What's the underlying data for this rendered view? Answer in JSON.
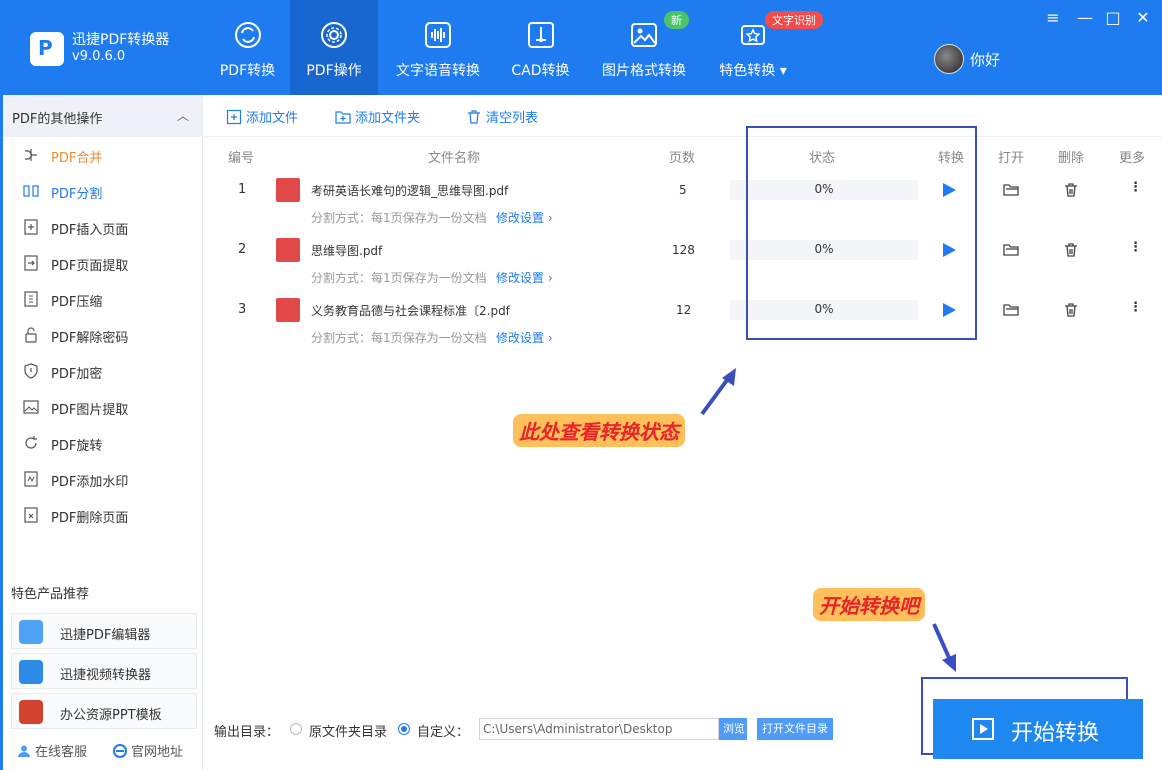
{
  "app": {
    "name": "迅捷PDF转换器",
    "version": "v9.0.6.0",
    "user": "你好"
  },
  "nav": {
    "tabs": [
      {
        "label": "PDF转换"
      },
      {
        "label": "PDF操作"
      },
      {
        "label": "文字语音转换"
      },
      {
        "label": "CAD转换"
      },
      {
        "label": "图片格式转换",
        "badge": "新"
      },
      {
        "label": "特色转换",
        "badge": "文字识别"
      }
    ],
    "window_controls": [
      "≡",
      "—",
      "□",
      "✕"
    ]
  },
  "sidebar": {
    "header": "PDF的其他操作",
    "items": [
      {
        "label": "PDF合并"
      },
      {
        "label": "PDF分割"
      },
      {
        "label": "PDF插入页面"
      },
      {
        "label": "PDF页面提取"
      },
      {
        "label": "PDF压缩"
      },
      {
        "label": "PDF解除密码"
      },
      {
        "label": "PDF加密"
      },
      {
        "label": "PDF图片提取"
      },
      {
        "label": "PDF旋转"
      },
      {
        "label": "PDF添加水印"
      },
      {
        "label": "PDF删除页面"
      }
    ],
    "rec_title": "特色产品推荐",
    "recommend": [
      {
        "label": "迅捷PDF编辑器"
      },
      {
        "label": "迅捷视频转换器"
      },
      {
        "label": "办公资源PPT模板"
      }
    ],
    "footer": {
      "service": "在线客服",
      "website": "官网地址"
    }
  },
  "toolbar": {
    "add_file": "添加文件",
    "add_folder": "添加文件夹",
    "clear_list": "清空列表"
  },
  "table": {
    "headers": [
      "编号",
      "文件名称",
      "页数",
      "状态",
      "转换",
      "打开",
      "删除",
      "更多"
    ],
    "rows": [
      {
        "num": "1",
        "name": "考研英语长难句的逻辑_思维导图.pdf",
        "pages": "5",
        "progress": "0%",
        "split": "分割方式：每1页保存为一份文档",
        "modify": "修改设置 ›"
      },
      {
        "num": "2",
        "name": "思维导图.pdf",
        "pages": "128",
        "progress": "0%",
        "split": "分割方式：每1页保存为一份文档",
        "modify": "修改设置 ›"
      },
      {
        "num": "3",
        "name": "义务教育品德与社会课程标准〔2.pdf",
        "pages": "12",
        "progress": "0%",
        "split": "分割方式：每1页保存为一份文档",
        "modify": "修改设置 ›"
      }
    ]
  },
  "annotations": {
    "status_note": "此处查看转换状态",
    "start_note": "开始转换吧"
  },
  "output": {
    "label": "输出目录：",
    "option_original": "原文件夹目录",
    "option_custom": "自定义：",
    "path": "C:\\Users\\Administrator\\Desktop",
    "browse": "浏览",
    "open_dir": "打开文件目录"
  },
  "start_button": "开始转换",
  "colors": {
    "primary": "#1f7bf0",
    "accent_orange": "#f08a2b",
    "annotation_box": "#3a4fbf",
    "callout_bg": "#ffbf5a",
    "callout_text": "#e8232a"
  }
}
